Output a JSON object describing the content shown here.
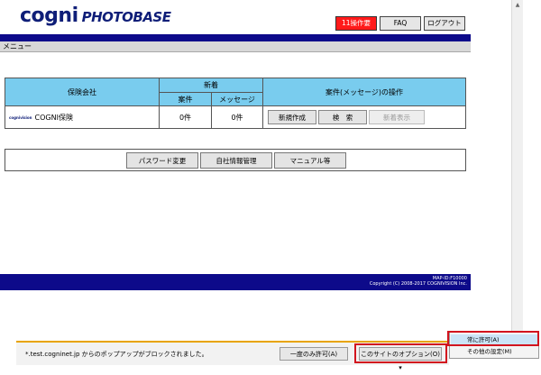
{
  "header": {
    "logo_cogni": "cogni",
    "logo_photobase": "PHOTOBASE",
    "buttons": {
      "operations": "11操作要",
      "faq": "FAQ",
      "logout": "ログアウト"
    }
  },
  "menu_bar": {
    "label": "メニュー"
  },
  "table": {
    "headers": {
      "company": "保険会社",
      "new_group": "新着",
      "cases": "案件",
      "messages": "メッセージ",
      "operations": "案件(メッセージ)の操作"
    },
    "rows": [
      {
        "logo_text": "cognivision",
        "company": "COGNI保険",
        "cases": "0件",
        "messages": "0件",
        "buttons": {
          "new": "新規作成",
          "search": "検　索",
          "news": "新着表示"
        }
      }
    ]
  },
  "bottom_buttons": {
    "password": "パスワード変更",
    "company_info": "自社情報管理",
    "manual": "マニュアル等"
  },
  "footer": {
    "map_id": "MAP-ID:F10000",
    "copyright": "Copyright (C) 2008-2017 COGNIVISION Inc."
  },
  "notification": {
    "message": "*.test.cogninet.jp からのポップアップがブロックされました。",
    "allow_once": "一度のみ許可(A)",
    "site_options": "このサイトのオプション(O) ▾"
  },
  "context_menu": {
    "items": [
      "常に許可(A)",
      "その他の設定(M)"
    ]
  },
  "colors": {
    "brand_navy": "#0d0a8a",
    "table_header": "#79ccee",
    "alert_red": "#ff1a1a",
    "highlight_red": "#d2141e"
  }
}
